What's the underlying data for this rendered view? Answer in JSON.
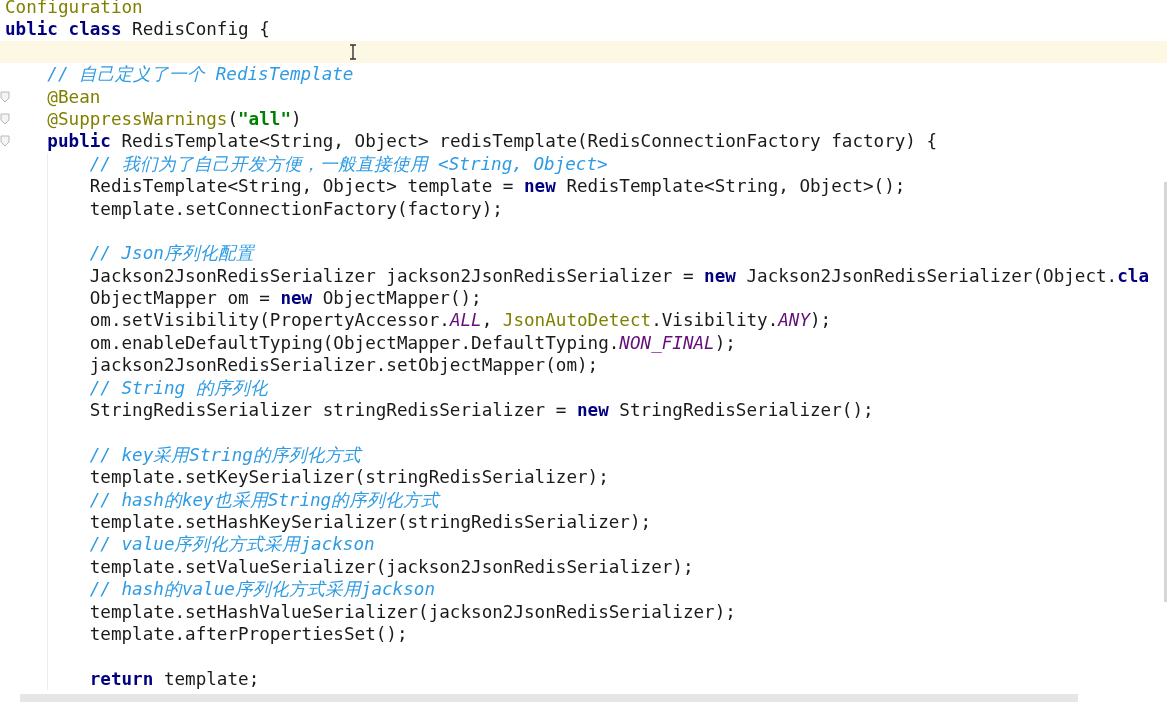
{
  "editor": {
    "lines": [
      {
        "tokens": [
          {
            "kind": "annotation",
            "text": "Configuration"
          }
        ],
        "current": false,
        "fold_marker": false
      },
      {
        "tokens": [
          {
            "kind": "keyword",
            "text": "ublic class"
          },
          {
            "kind": "plain",
            "text": " RedisConfig {"
          }
        ],
        "current": false,
        "fold_marker": false,
        "children": [
          {
            "current": true,
            "fold_marker": false
          },
          {
            "tokens": [
              {
                "kind": "comment",
                "text": "// 自己定义了一个 RedisTemplate"
              }
            ],
            "current": false,
            "fold_marker": false
          },
          {
            "tokens": [
              {
                "kind": "annotation",
                "text": "@Bean"
              }
            ],
            "current": false,
            "fold_marker": true
          },
          {
            "tokens": [
              {
                "kind": "annotation",
                "text": "@SuppressWarnings"
              },
              {
                "kind": "plain",
                "text": "("
              },
              {
                "kind": "string",
                "text": "\"all\""
              },
              {
                "kind": "plain",
                "text": ")"
              }
            ],
            "current": false,
            "fold_marker": true
          },
          {
            "tokens": [
              {
                "kind": "keyword",
                "text": "public"
              },
              {
                "kind": "plain",
                "text": " RedisTemplate<String, Object> redisTemplate(RedisConnectionFactory factory) {"
              }
            ],
            "current": false,
            "fold_marker": true,
            "children": [
              {
                "tokens": [
                  {
                    "kind": "comment",
                    "text": "// 我们为了自己开发方便，一般直接使用 <String, Object>"
                  }
                ],
                "current": false,
                "fold_marker": false
              },
              {
                "tokens": [
                  {
                    "kind": "plain",
                    "text": "RedisTemplate<String, Object> template = "
                  },
                  {
                    "kind": "keyword",
                    "text": "new"
                  },
                  {
                    "kind": "plain",
                    "text": " RedisTemplate<String, Object>();"
                  }
                ],
                "current": false,
                "fold_marker": false
              },
              {
                "tokens": [
                  {
                    "kind": "plain",
                    "text": "template.setConnectionFactory(factory);"
                  }
                ],
                "current": false,
                "fold_marker": false
              },
              {
                "current": false,
                "fold_marker": false
              },
              {
                "tokens": [
                  {
                    "kind": "comment",
                    "text": "// Json序列化配置"
                  }
                ],
                "current": false,
                "fold_marker": false
              },
              {
                "tokens": [
                  {
                    "kind": "plain",
                    "text": "Jackson2JsonRedisSerializer jackson2JsonRedisSerializer = "
                  },
                  {
                    "kind": "keyword",
                    "text": "new"
                  },
                  {
                    "kind": "plain",
                    "text": " Jackson2JsonRedisSerializer(Object."
                  },
                  {
                    "kind": "keyword",
                    "text": "cla"
                  }
                ],
                "current": false,
                "fold_marker": false
              },
              {
                "tokens": [
                  {
                    "kind": "plain",
                    "text": "ObjectMapper om = "
                  },
                  {
                    "kind": "keyword",
                    "text": "new"
                  },
                  {
                    "kind": "plain",
                    "text": " ObjectMapper();"
                  }
                ],
                "current": false,
                "fold_marker": false
              },
              {
                "tokens": [
                  {
                    "kind": "plain",
                    "text": "om.setVisibility(PropertyAccessor."
                  },
                  {
                    "kind": "constant",
                    "text": "ALL"
                  },
                  {
                    "kind": "plain",
                    "text": ", "
                  },
                  {
                    "kind": "type",
                    "text": "JsonAutoDetect"
                  },
                  {
                    "kind": "plain",
                    "text": ".Visibility."
                  },
                  {
                    "kind": "constant",
                    "text": "ANY"
                  },
                  {
                    "kind": "plain",
                    "text": ");"
                  }
                ],
                "current": false,
                "fold_marker": false
              },
              {
                "tokens": [
                  {
                    "kind": "plain",
                    "text": "om.enableDefaultTyping(ObjectMapper.DefaultTyping."
                  },
                  {
                    "kind": "constant",
                    "text": "NON_FINAL"
                  },
                  {
                    "kind": "plain",
                    "text": ");"
                  }
                ],
                "current": false,
                "fold_marker": false
              },
              {
                "tokens": [
                  {
                    "kind": "plain",
                    "text": "jackson2JsonRedisSerializer.setObjectMapper(om);"
                  }
                ],
                "current": false,
                "fold_marker": false
              },
              {
                "tokens": [
                  {
                    "kind": "comment",
                    "text": "// String 的序列化"
                  }
                ],
                "current": false,
                "fold_marker": false
              },
              {
                "tokens": [
                  {
                    "kind": "plain",
                    "text": "StringRedisSerializer stringRedisSerializer = "
                  },
                  {
                    "kind": "keyword",
                    "text": "new"
                  },
                  {
                    "kind": "plain",
                    "text": " StringRedisSerializer();"
                  }
                ],
                "current": false,
                "fold_marker": false
              },
              {
                "current": false,
                "fold_marker": false
              },
              {
                "tokens": [
                  {
                    "kind": "comment",
                    "text": "// key采用String的序列化方式"
                  }
                ],
                "current": false,
                "fold_marker": false
              },
              {
                "tokens": [
                  {
                    "kind": "plain",
                    "text": "template.setKeySerializer(stringRedisSerializer);"
                  }
                ],
                "current": false,
                "fold_marker": false
              },
              {
                "tokens": [
                  {
                    "kind": "comment",
                    "text": "// hash的key也采用String的序列化方式"
                  }
                ],
                "current": false,
                "fold_marker": false
              },
              {
                "tokens": [
                  {
                    "kind": "plain",
                    "text": "template.setHashKeySerializer(stringRedisSerializer);"
                  }
                ],
                "current": false,
                "fold_marker": false
              },
              {
                "tokens": [
                  {
                    "kind": "comment",
                    "text": "// value序列化方式采用jackson"
                  }
                ],
                "current": false,
                "fold_marker": false
              },
              {
                "tokens": [
                  {
                    "kind": "plain",
                    "text": "template.setValueSerializer(jackson2JsonRedisSerializer);"
                  }
                ],
                "current": false,
                "fold_marker": false
              },
              {
                "tokens": [
                  {
                    "kind": "comment",
                    "text": "// hash的value序列化方式采用jackson"
                  }
                ],
                "current": false,
                "fold_marker": false
              },
              {
                "tokens": [
                  {
                    "kind": "plain",
                    "text": "template.setHashValueSerializer(jackson2JsonRedisSerializer);"
                  }
                ],
                "current": false,
                "fold_marker": false
              },
              {
                "tokens": [
                  {
                    "kind": "plain",
                    "text": "template.afterPropertiesSet();"
                  }
                ],
                "current": false,
                "fold_marker": false
              },
              {
                "current": false,
                "fold_marker": false
              },
              {
                "tokens": [
                  {
                    "kind": "keyword",
                    "text": "return"
                  },
                  {
                    "kind": "plain",
                    "text": " template;"
                  }
                ],
                "current": false,
                "fold_marker": false
              }
            ]
          }
        ]
      }
    ]
  }
}
